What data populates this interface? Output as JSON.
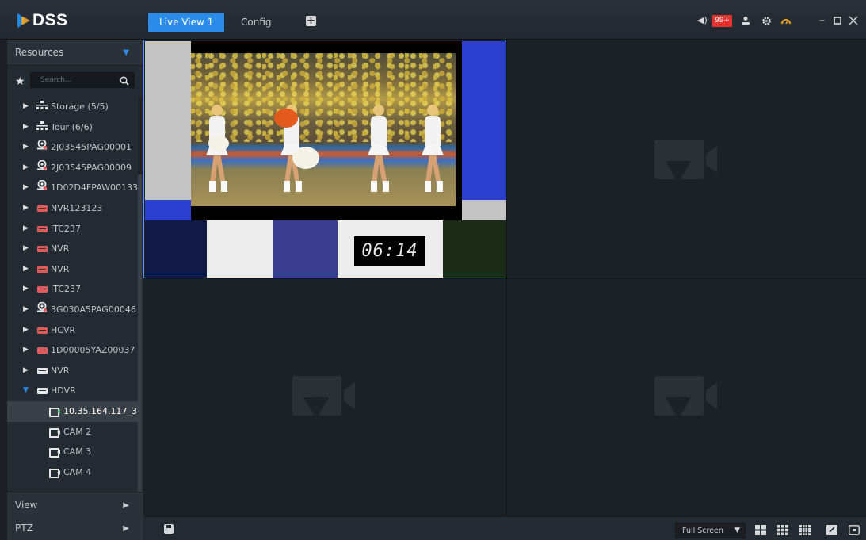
{
  "app": {
    "logo_text": "DSS"
  },
  "tabs": [
    {
      "label": "Live View 1",
      "active": true
    },
    {
      "label": "Config",
      "active": false
    }
  ],
  "topbar": {
    "alarm_badge": "99+",
    "icons": [
      "volume-icon",
      "user-icon",
      "settings-icon",
      "performance-gauge-icon",
      "minimize-icon",
      "maximize-icon",
      "close-icon"
    ]
  },
  "sidebar": {
    "resources_label": "Resources",
    "search_placeholder": "Search...",
    "tree": [
      {
        "label": "Storage (5/5)",
        "icon": "group-icon",
        "expanded": false
      },
      {
        "label": "Tour (6/6)",
        "icon": "group-icon",
        "expanded": false
      },
      {
        "label": "2J03545PAG00001",
        "icon": "ipc-icon",
        "expanded": false
      },
      {
        "label": "2J03545PAG00009",
        "icon": "ipc-icon",
        "expanded": false
      },
      {
        "label": "1D02D4FPAW00133",
        "icon": "ipc-icon",
        "expanded": false
      },
      {
        "label": "NVR123123",
        "icon": "device-offline-icon",
        "expanded": false
      },
      {
        "label": "ITC237",
        "icon": "device-offline-icon",
        "expanded": false
      },
      {
        "label": "NVR",
        "icon": "device-offline-icon",
        "expanded": false
      },
      {
        "label": "NVR",
        "icon": "device-offline-icon",
        "expanded": false
      },
      {
        "label": "ITC237",
        "icon": "device-offline-icon",
        "expanded": false
      },
      {
        "label": "3G030A5PAG00046",
        "icon": "ipc-icon",
        "expanded": false
      },
      {
        "label": "HCVR",
        "icon": "device-offline-icon",
        "expanded": false
      },
      {
        "label": "1D00005YAZ00037",
        "icon": "device-offline-icon",
        "expanded": false
      },
      {
        "label": "NVR",
        "icon": "device-online-icon",
        "expanded": false
      },
      {
        "label": "HDVR",
        "icon": "device-online-icon",
        "expanded": true
      },
      {
        "label": "10.35.164.117_3",
        "icon": "camera-playing-icon",
        "child": true,
        "selected": true
      },
      {
        "label": "CAM 2",
        "icon": "camera-icon",
        "child": true
      },
      {
        "label": "CAM 3",
        "icon": "camera-icon",
        "child": true
      },
      {
        "label": "CAM 4",
        "icon": "camera-icon",
        "child": true
      }
    ],
    "view_label": "View",
    "ptz_label": "PTZ"
  },
  "video": {
    "clock": "06:14"
  },
  "bottombar": {
    "fullscreen_label": "Full Screen"
  },
  "colors": {
    "accent": "#2a8be8",
    "badge": "#e3322d",
    "selected_border": "#4ba3ff"
  }
}
